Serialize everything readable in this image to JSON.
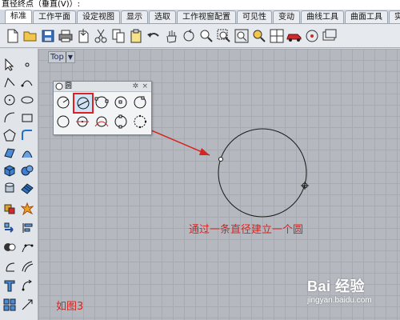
{
  "command_line": "直径终点（垂直(V)）:",
  "tabs": [
    {
      "label": "标准"
    },
    {
      "label": "工作平面"
    },
    {
      "label": "设定视图"
    },
    {
      "label": "显示"
    },
    {
      "label": "选取"
    },
    {
      "label": "工作视窗配置"
    },
    {
      "label": "可见性"
    },
    {
      "label": "变动"
    },
    {
      "label": "曲线工具"
    },
    {
      "label": "曲面工具"
    },
    {
      "label": "实"
    }
  ],
  "toolbar_icons": [
    "new-file-icon",
    "open-folder-icon",
    "save-icon",
    "print-icon",
    "import-icon",
    "cut-icon",
    "copy-icon",
    "paste-icon",
    "undo-icon",
    "pan-hand-icon",
    "rotate-icon",
    "zoom-icon",
    "zoom-window-icon",
    "zoom-extents-icon",
    "zoom-selected-icon",
    "four-viewports-icon",
    "car-render-icon",
    "circle-tool-icon",
    "layer-icon"
  ],
  "viewport": {
    "label": "Top"
  },
  "palette": {
    "title": "圆"
  },
  "annotation": {
    "text": "通过一条直径建立一个圆"
  },
  "figure_label": "如图3",
  "watermark": {
    "logo": "Bai 经验",
    "url": "jingyan.baidu.com"
  },
  "colors": {
    "annotation": "#d8231f",
    "highlight_box": "#e02020",
    "grid": "#b5b9bf"
  }
}
